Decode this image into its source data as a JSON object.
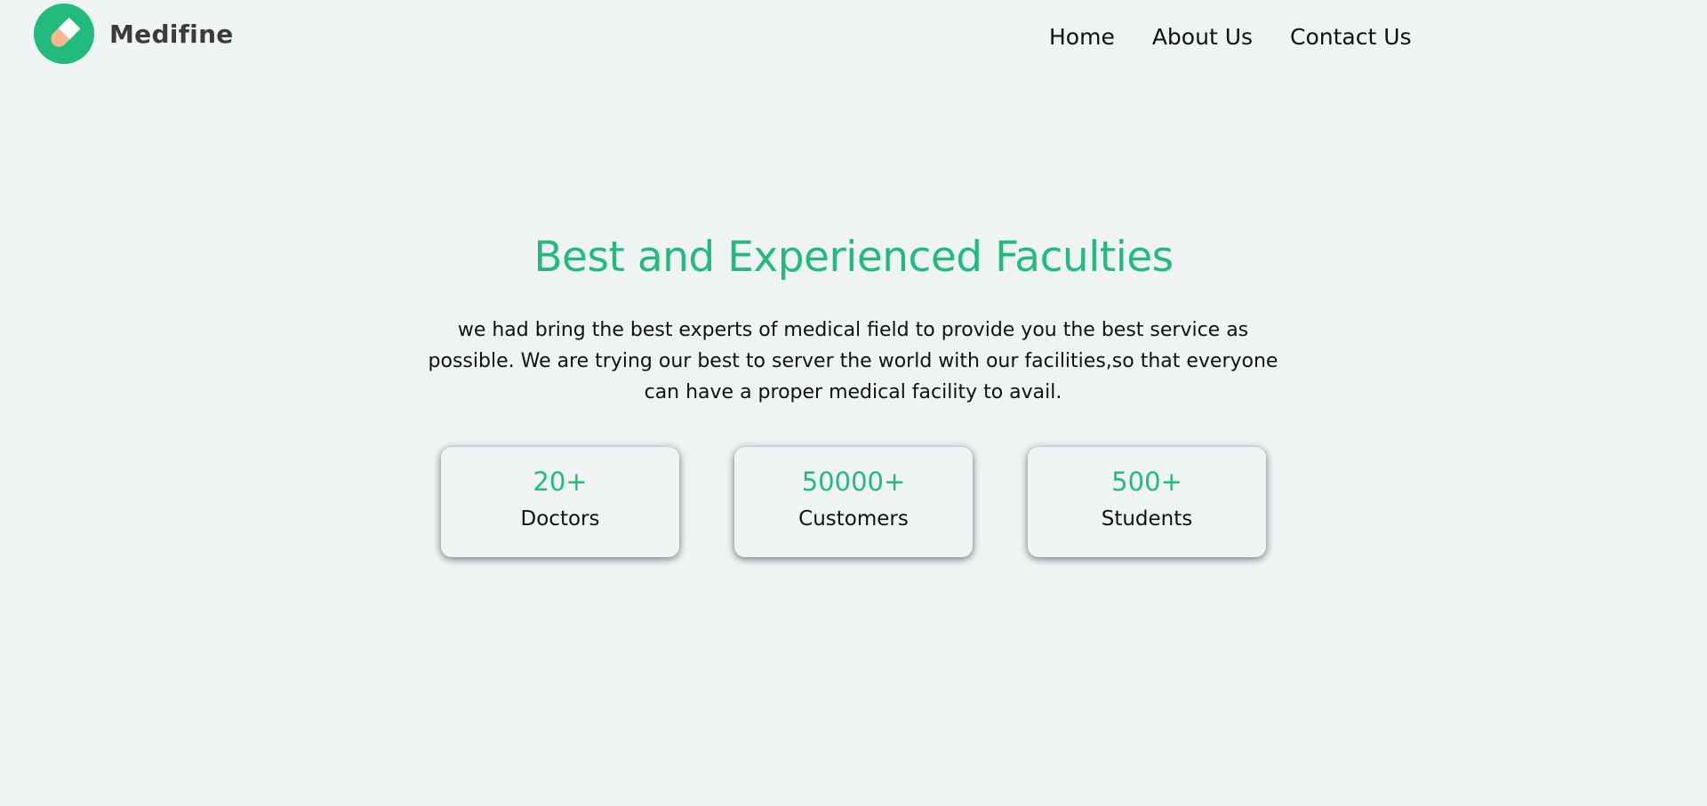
{
  "brand": {
    "name": "Medifine",
    "logo_icon": "pill-icon",
    "logo_color": "#22bb7d"
  },
  "nav": {
    "items": [
      {
        "label": "Home"
      },
      {
        "label": "About Us"
      },
      {
        "label": "Contact Us"
      }
    ]
  },
  "hero": {
    "title": "Best and Experienced Faculties",
    "description": "we had bring the best experts of medical field to provide you the best service as possible. We are trying our best to server the world with our facilities,so that everyone can have a proper medical facility to avail."
  },
  "stats": [
    {
      "value": "20+",
      "label": "Doctors"
    },
    {
      "value": "50000+",
      "label": "Customers"
    },
    {
      "value": "500+",
      "label": "Students"
    }
  ],
  "colors": {
    "accent": "#22bb7d",
    "background": "#eff3f4",
    "text": "#111111"
  }
}
